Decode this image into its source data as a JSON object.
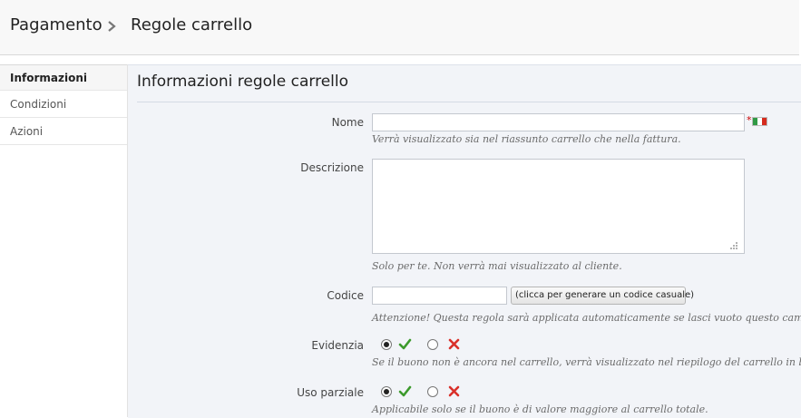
{
  "breadcrumb": {
    "parent": "Pagamento",
    "current": "Regole carrello",
    "separator_icon": "chevron-right-icon"
  },
  "tabs": [
    {
      "label": "Informazioni",
      "active": true
    },
    {
      "label": "Condizioni",
      "active": false
    },
    {
      "label": "Azioni",
      "active": false
    }
  ],
  "panel": {
    "title": "Informazioni regole carrello"
  },
  "form": {
    "name": {
      "label": "Nome",
      "value": "",
      "required_marker": "*",
      "language_flag": "italian-flag-icon",
      "hint": "Verrà visualizzato sia nel riassunto carrello che nella fattura."
    },
    "description": {
      "label": "Descrizione",
      "value": "",
      "hint": "Solo per te. Non verrà mai visualizzato al cliente."
    },
    "code": {
      "label": "Codice",
      "value": "",
      "generate_button": "(clicca per generare un codice casuale)",
      "hint": "Attenzione! Questa regola sarà applicata automaticamente se lasci vuoto questo campo."
    },
    "highlight": {
      "label": "Evidenzia",
      "selected": "yes",
      "hint": "Se il buono non è ancora nel carrello, verrà visualizzato nel riepilogo del carrello in basso."
    },
    "partial_use": {
      "label": "Uso parziale",
      "selected": "yes",
      "hint": "Applicabile solo se il buono è di valore maggiore al carrello totale."
    }
  },
  "colors": {
    "check_green": "#3c9a2c",
    "cross_red": "#d9302a",
    "panel_bg": "#f2f4f8",
    "flag_green": "#2f9a45",
    "flag_white": "#ffffff",
    "flag_red": "#d52b1e"
  }
}
